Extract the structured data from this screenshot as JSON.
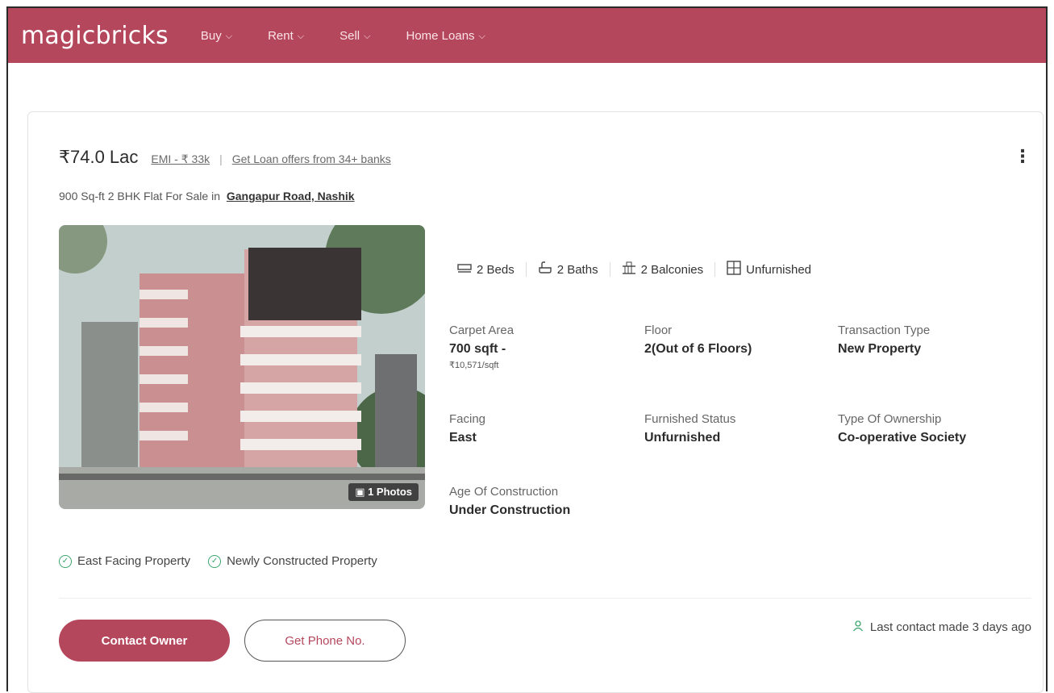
{
  "header": {
    "logo": "magicbricks",
    "nav": [
      {
        "label": "Buy"
      },
      {
        "label": "Rent"
      },
      {
        "label": "Sell"
      },
      {
        "label": "Home Loans"
      }
    ]
  },
  "listing": {
    "price": "₹74.0 Lac",
    "emi": "EMI - ₹ 33k",
    "separator": "|",
    "loan_offer": "Get Loan offers from 34+ banks",
    "subtitle_prefix": "900 Sq-ft 2 BHK Flat For Sale in",
    "location": "Gangapur Road, Nashik",
    "photo_badge": "1 Photos",
    "amenities": [
      {
        "label": "2 Beds",
        "icon": "bed-icon"
      },
      {
        "label": "2 Baths",
        "icon": "bath-icon"
      },
      {
        "label": "2 Balconies",
        "icon": "balcony-icon"
      },
      {
        "label": "Unfurnished",
        "icon": "furniture-icon"
      }
    ],
    "details": {
      "carpet_area": {
        "label": "Carpet Area",
        "value": "700 sqft -",
        "sub": "₹10,571/sqft"
      },
      "floor": {
        "label": "Floor",
        "value": "2(Out of 6 Floors)"
      },
      "transaction_type": {
        "label": "Transaction Type",
        "value": "New Property"
      },
      "facing": {
        "label": "Facing",
        "value": "East"
      },
      "furnished_status": {
        "label": "Furnished Status",
        "value": "Unfurnished"
      },
      "ownership": {
        "label": "Type Of Ownership",
        "value": "Co-operative Society"
      },
      "age": {
        "label": "Age Of Construction",
        "value": "Under Construction"
      }
    },
    "tags": [
      "East Facing Property",
      "Newly Constructed Property"
    ],
    "actions": {
      "contact_owner": "Contact Owner",
      "get_phone": "Get Phone No."
    },
    "last_contact": "Last contact made 3 days ago"
  },
  "colors": {
    "brand": "#b5475c",
    "check": "#3aa56b"
  }
}
